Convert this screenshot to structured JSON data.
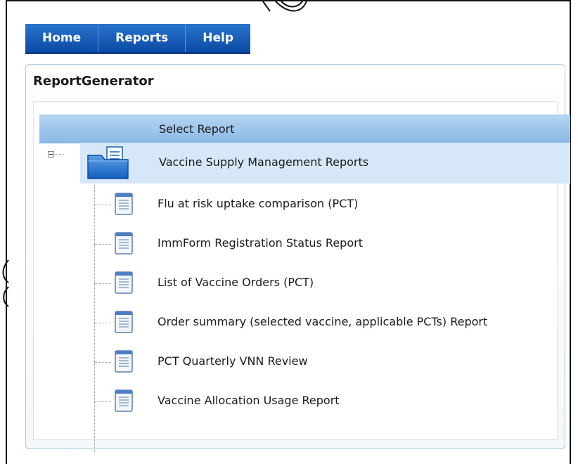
{
  "nav": {
    "items": [
      {
        "label": "Home"
      },
      {
        "label": "Reports"
      },
      {
        "label": "Help"
      }
    ]
  },
  "panel": {
    "title": "ReportGenerator"
  },
  "tree": {
    "header": "Select Report",
    "folder": {
      "label": "Vaccine Supply Management Reports",
      "icon": "folder-icon"
    },
    "reports": [
      {
        "label": "Flu at risk uptake comparison (PCT)",
        "icon": "report-document-icon"
      },
      {
        "label": "ImmForm Registration Status Report",
        "icon": "report-document-icon"
      },
      {
        "label": "List of Vaccine Orders (PCT)",
        "icon": "report-document-icon"
      },
      {
        "label": "Order summary (selected vaccine, applicable PCTs) Report",
        "icon": "report-document-icon"
      },
      {
        "label": "PCT Quarterly VNN Review",
        "icon": "report-document-icon"
      },
      {
        "label": "Vaccine Allocation Usage Report",
        "icon": "report-document-icon"
      }
    ]
  },
  "colors": {
    "nav_bg": "#1258b8",
    "header_bg": "#a5c9ee",
    "selected_row_bg": "#d6e8f8",
    "panel_border": "#a9c8dc"
  }
}
